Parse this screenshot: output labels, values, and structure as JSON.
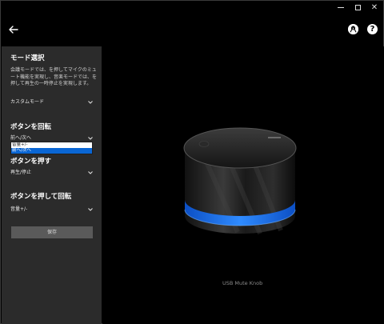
{
  "window": {
    "controls": {
      "minimize": "minimize",
      "maximize": "maximize",
      "close": "close"
    }
  },
  "header": {
    "back_icon": "arrow-left-icon",
    "user_icon": "user-circle-icon",
    "help_icon": "help-circle-icon",
    "help_glyph": "?"
  },
  "sidebar": {
    "mode": {
      "title": "モード選択",
      "description": "会議モードでは、を押してマイクのミュート機能を実現し、音楽モードでは、を押して再生の一時停止を実現します。",
      "value": "カスタムモード"
    },
    "rotate": {
      "title": "ボタンを回転",
      "value": "前へ/次へ",
      "options": [
        "音量+/-",
        "前へ/次へ"
      ],
      "selected_index": 1
    },
    "press": {
      "title": "ボタンを押す",
      "value": "再生/停止"
    },
    "press_rotate": {
      "title": "ボタンを押して回転",
      "value": "音量+/-"
    },
    "save_label": "保存"
  },
  "device": {
    "caption": "USB Mute Knob",
    "ring_color": "#1f7bff"
  },
  "colors": {
    "sidebar_bg": "#2b2b2b",
    "selected": "#0a66d4",
    "button_bg": "#5a5a5a"
  }
}
